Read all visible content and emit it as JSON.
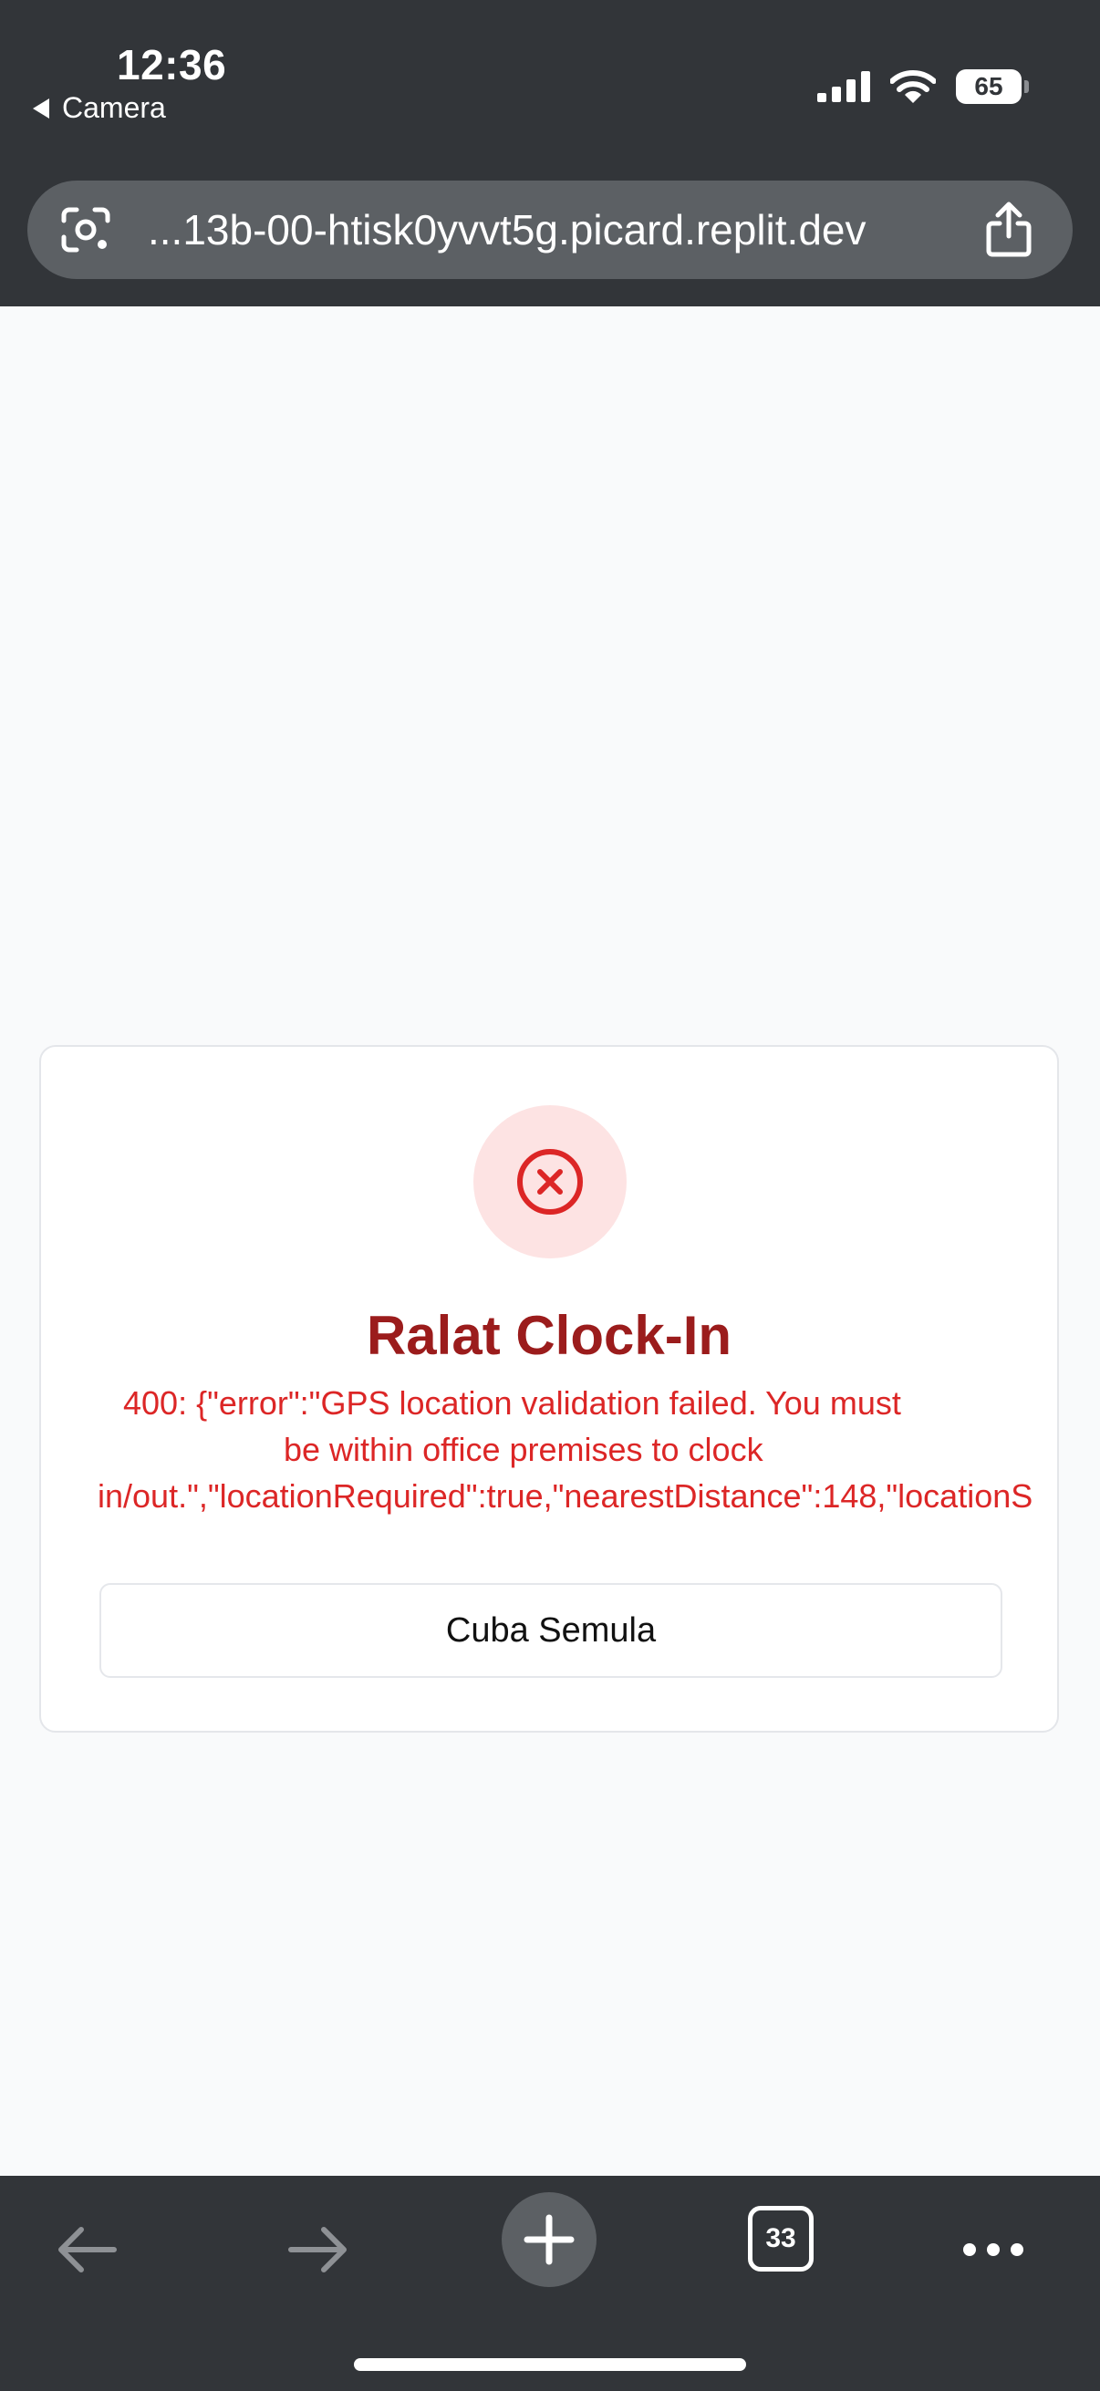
{
  "status_bar": {
    "time": "12:36",
    "back_app_label": "Camera",
    "battery": "65"
  },
  "browser": {
    "url": "...13b-00-htisk0yvvt5g.picard.replit.dev",
    "tab_count": "33"
  },
  "card": {
    "title": "Ralat Clock-In",
    "error_lines": [
      "400: {\"error\":\"GPS location validation failed. You must",
      "be within office premises to clock",
      "in/out.\",\"locationRequired\":true,\"nearestDistance\":148,\"locationS"
    ],
    "retry_label": "Cuba Semula"
  },
  "icons": {
    "error": "x-circle-icon",
    "lens": "google-lens-icon",
    "share": "share-icon",
    "back": "arrow-left-icon",
    "forward": "arrow-right-icon",
    "new_tab": "plus-icon",
    "more": "ellipsis-icon"
  },
  "colors": {
    "chrome_bg": "#323539",
    "page_bg": "#f9fafb",
    "error_red": "#dc2626",
    "title_red": "#9b1c1c",
    "error_icon_bg": "#fde3e3"
  }
}
